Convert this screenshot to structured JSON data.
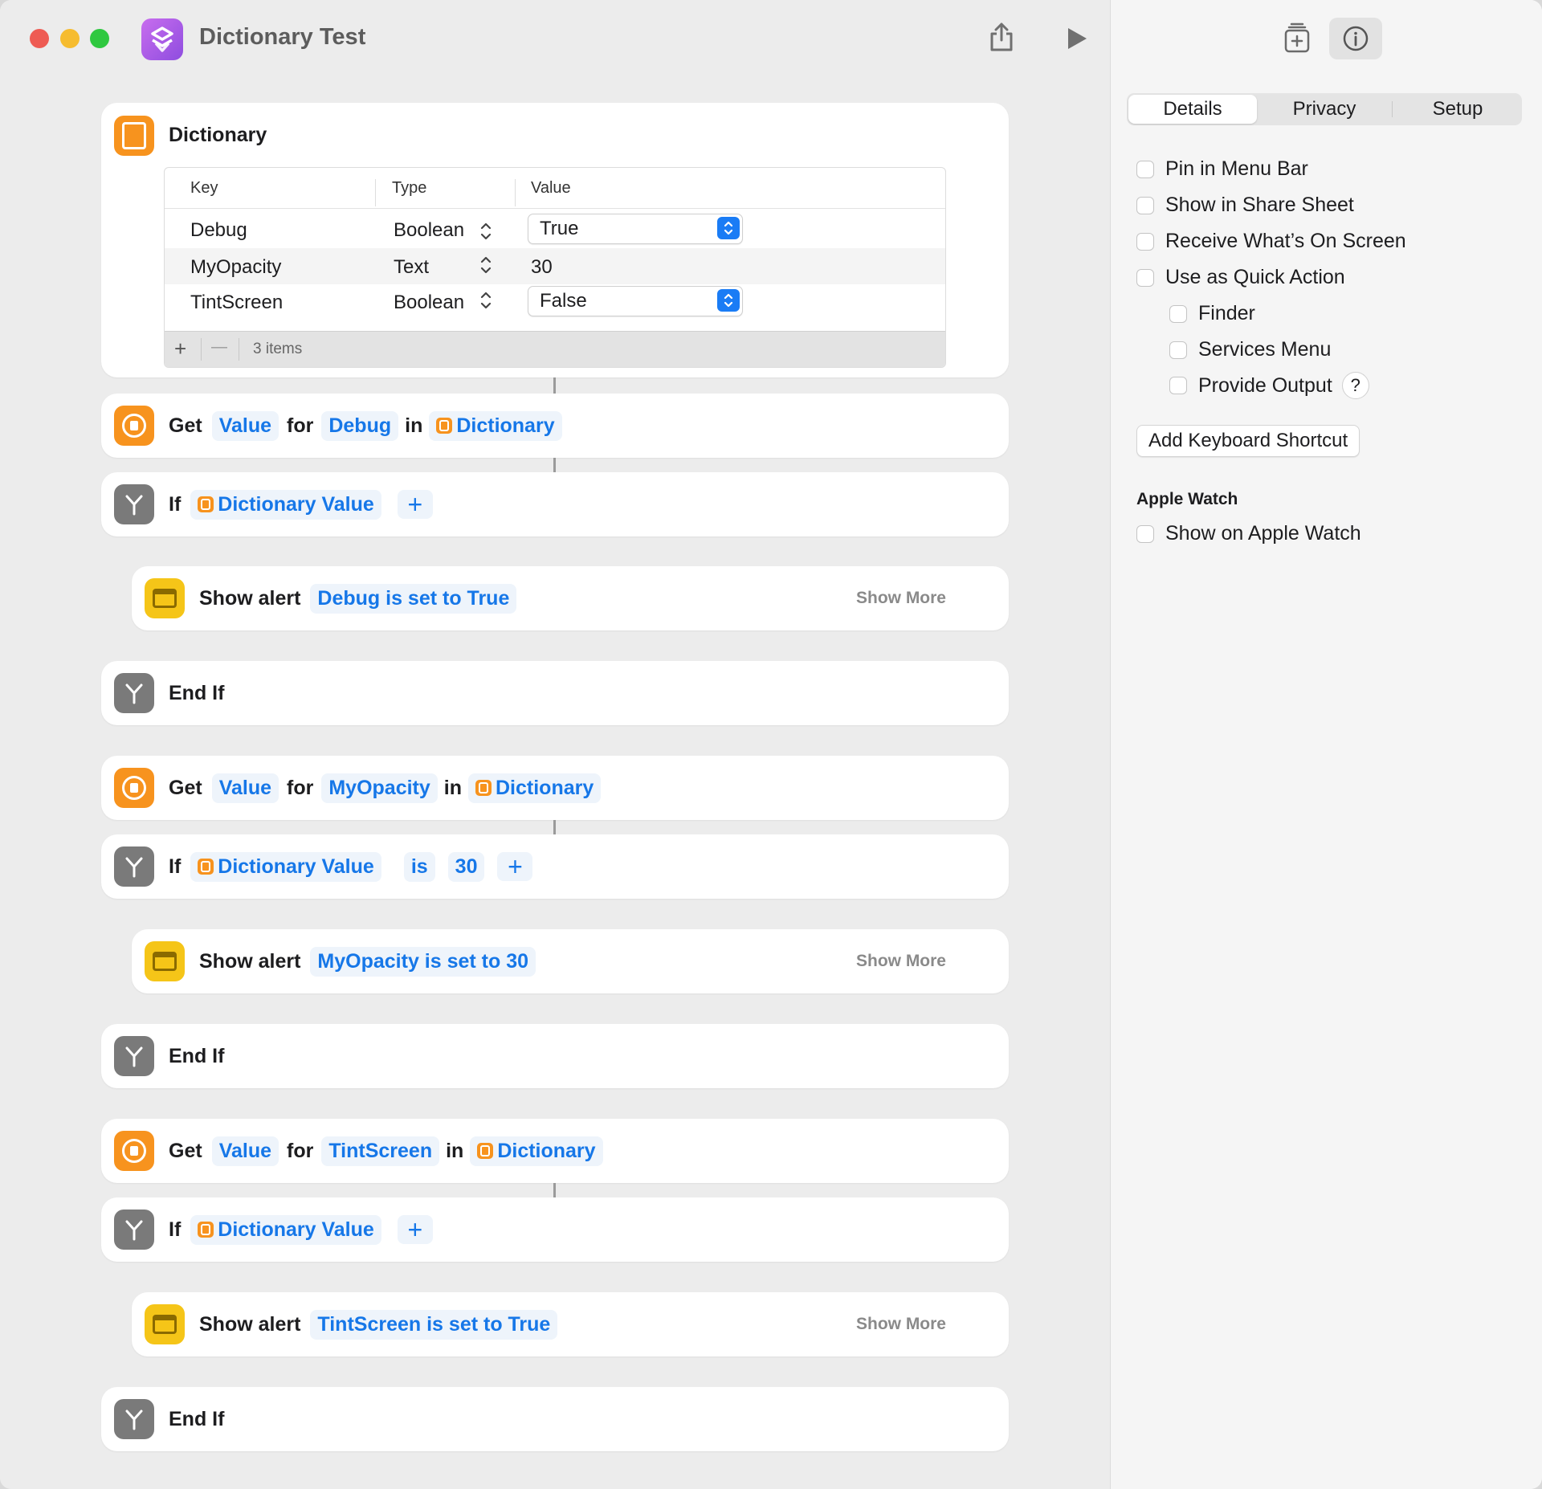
{
  "window": {
    "title": "Dictionary Test"
  },
  "dictionary": {
    "title": "Dictionary",
    "headers": {
      "key": "Key",
      "type": "Type",
      "value": "Value"
    },
    "rows": [
      {
        "key": "Debug",
        "type": "Boolean",
        "value": "True"
      },
      {
        "key": "MyOpacity",
        "type": "Text",
        "value": "30"
      },
      {
        "key": "TintScreen",
        "type": "Boolean",
        "value": "False"
      }
    ],
    "footer": {
      "plus": "+",
      "minus": "—",
      "count": "3 items"
    }
  },
  "actions": {
    "get1": {
      "verb": "Get",
      "value": "Value",
      "for": "for",
      "key": "Debug",
      "in": "in",
      "dict": "Dictionary"
    },
    "if1": {
      "verb": "If",
      "input": "Dictionary Value",
      "plus": "+"
    },
    "alert1": {
      "verb": "Show alert",
      "message": "Debug is set to True",
      "more": "Show More"
    },
    "end1": {
      "label": "End If"
    },
    "get2": {
      "verb": "Get",
      "value": "Value",
      "for": "for",
      "key": "MyOpacity",
      "in": "in",
      "dict": "Dictionary"
    },
    "if2": {
      "verb": "If",
      "input": "Dictionary Value",
      "op": "is",
      "cmp": "30",
      "plus": "+"
    },
    "alert2": {
      "verb": "Show alert",
      "message": "MyOpacity is set to 30",
      "more": "Show More"
    },
    "end2": {
      "label": "End If"
    },
    "get3": {
      "verb": "Get",
      "value": "Value",
      "for": "for",
      "key": "TintScreen",
      "in": "in",
      "dict": "Dictionary"
    },
    "if3": {
      "verb": "If",
      "input": "Dictionary Value",
      "plus": "+"
    },
    "alert3": {
      "verb": "Show alert",
      "message": "TintScreen is set to True",
      "more": "Show More"
    },
    "end3": {
      "label": "End If"
    }
  },
  "sidebar": {
    "tabs": [
      "Details",
      "Privacy",
      "Setup"
    ],
    "selected_tab": "Details",
    "options": [
      "Pin in Menu Bar",
      "Show in Share Sheet",
      "Receive What’s On Screen",
      "Use as Quick Action"
    ],
    "sub_options": [
      "Finder",
      "Services Menu",
      "Provide Output"
    ],
    "help": "?",
    "keyboard_button": "Add Keyboard Shortcut",
    "apple_watch_title": "Apple Watch",
    "apple_watch_option": "Show on Apple Watch"
  },
  "colors": {
    "accent": "#1677e8",
    "orange": "#f7931e",
    "yellow": "#f5c518",
    "gray_icon": "#7a7a7a",
    "close": "#ee5b53",
    "minimize": "#f6bc2f",
    "zoom": "#2fc840"
  }
}
